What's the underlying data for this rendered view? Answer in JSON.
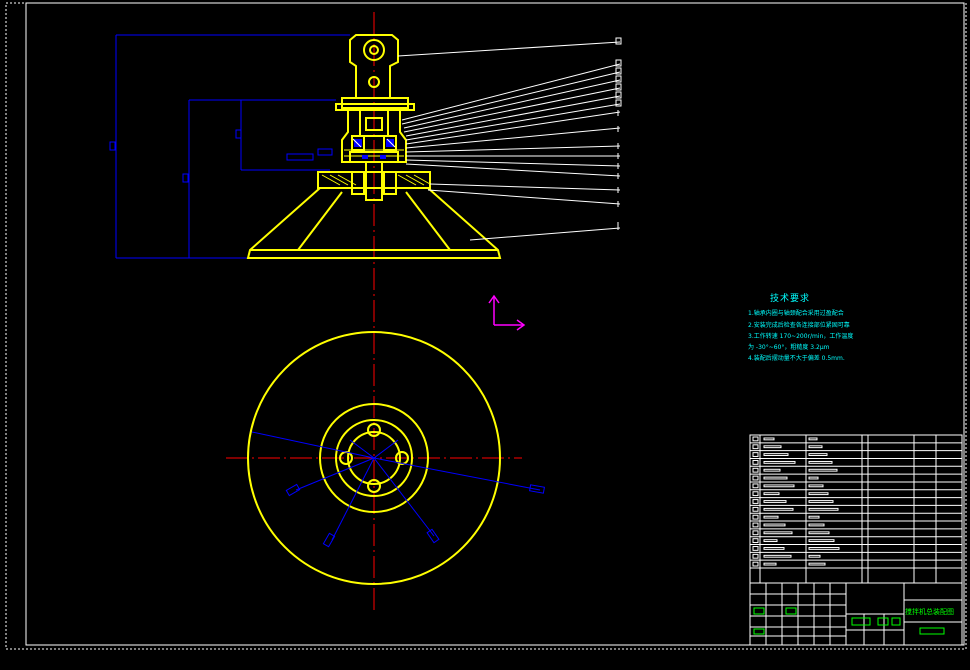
{
  "drawing": {
    "background": "#000000",
    "colors": {
      "border": "#ffffff",
      "part": "#ffff00",
      "dimension": "#0000ff",
      "centerline": "#ff0000",
      "leader": "#ffffff",
      "ucs": "#ff00ff",
      "notes": "#00ffff",
      "titleblock_text": "#00ff00"
    }
  },
  "tech_requirements": {
    "title": "技术要求",
    "lines": [
      "1.轴承内圈与轴颈配合采用过盈配合",
      "2.安装完成后检查各连接部位紧固可靠",
      "3.工作转速   170~200r/min，工作温度",
      "为 -30°~60°，粗糙度 3.2μm",
      "4.装配后摆动量不大于偏差 0.5mm."
    ]
  },
  "title_block": {
    "drawing_name": "搅拌机总装配图"
  },
  "icons": {
    "ucs": "ucs-axis-icon"
  }
}
